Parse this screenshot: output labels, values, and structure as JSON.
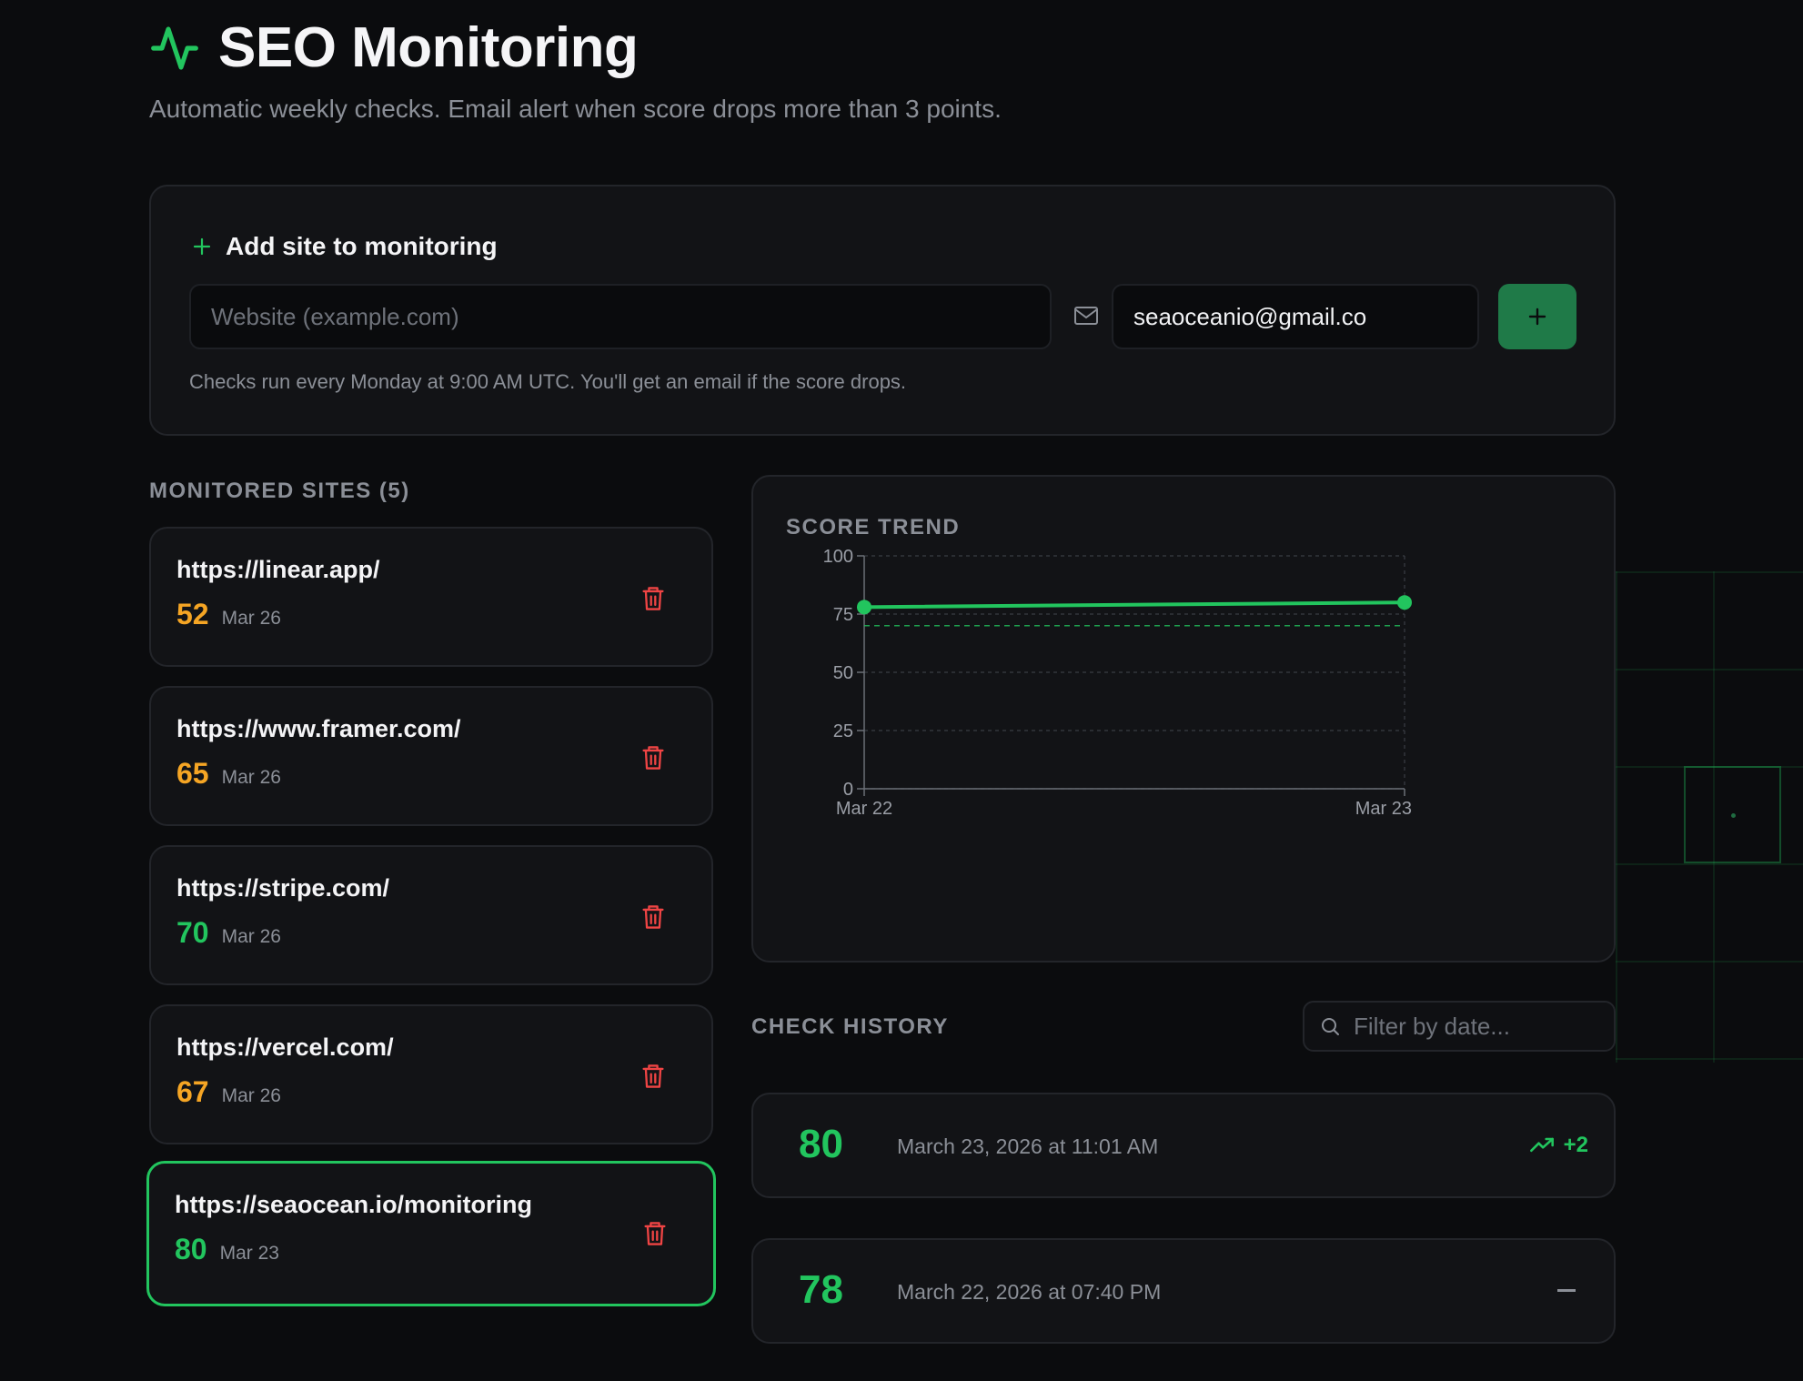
{
  "header": {
    "title": "SEO Monitoring",
    "subtitle": "Automatic weekly checks. Email alert when score drops more than 3 points.",
    "icon": "activity-icon"
  },
  "add_site": {
    "title": "Add site to monitoring",
    "website_placeholder": "Website (example.com)",
    "email_value": "seaoceanio@gmail.co",
    "add_button_icon": "plus-icon",
    "note": "Checks run every Monday at 9:00 AM UTC. You'll get an email if the score drops."
  },
  "sites": {
    "label": "MONITORED SITES (5)",
    "items": [
      {
        "url": "https://linear.app/",
        "score": "52",
        "date": "Mar 26",
        "color": "#f5a524"
      },
      {
        "url": "https://www.framer.com/",
        "score": "65",
        "date": "Mar 26",
        "color": "#f5a524"
      },
      {
        "url": "https://stripe.com/",
        "score": "70",
        "date": "Mar 26",
        "color": "#22c55e"
      },
      {
        "url": "https://vercel.com/",
        "score": "67",
        "date": "Mar 26",
        "color": "#f5a524"
      },
      {
        "url": "https://seaocean.io/monitoring",
        "score": "80",
        "date": "Mar 23",
        "color": "#22c55e",
        "selected": true
      }
    ]
  },
  "chart": {
    "label": "SCORE TREND"
  },
  "chart_data": {
    "type": "line",
    "x": [
      "Mar 22",
      "Mar 23"
    ],
    "series": [
      {
        "values": [
          78,
          80
        ],
        "color": "#22c55e"
      }
    ],
    "yticks": [
      0,
      25,
      50,
      75,
      100
    ],
    "ylim": [
      0,
      100
    ],
    "threshold": 70,
    "grid": true
  },
  "history": {
    "label": "CHECK HISTORY",
    "filter_placeholder": "Filter by date...",
    "items": [
      {
        "score": "80",
        "date": "March 23, 2026 at 11:01 AM",
        "delta": "+2"
      },
      {
        "score": "78",
        "date": "March 22, 2026 at 07:40 PM",
        "delta": ""
      }
    ]
  },
  "colors": {
    "accent": "#22c55e",
    "warning": "#f5a524",
    "danger": "#ef4444"
  }
}
